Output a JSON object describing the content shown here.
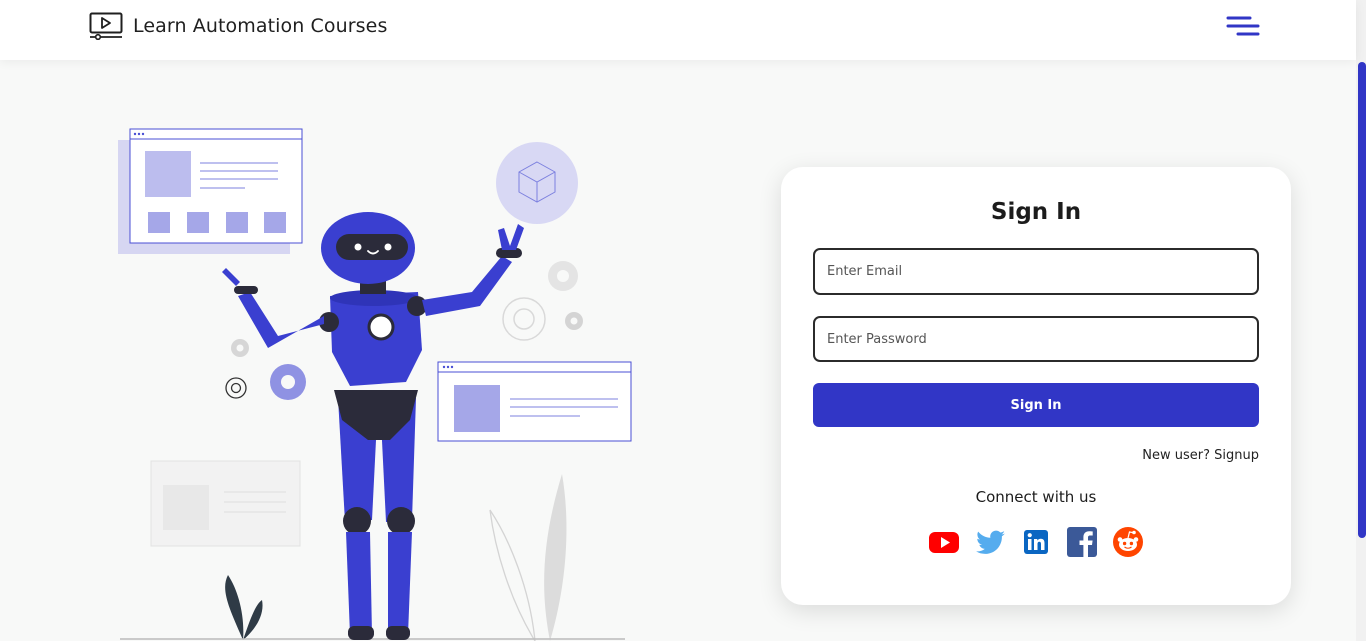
{
  "navbar": {
    "brand_title": "Learn Automation Courses",
    "brand_icon": "video-player-icon",
    "menu_icon": "hamburger-menu-icon"
  },
  "signin": {
    "heading": "Sign In",
    "email_placeholder": "Enter Email",
    "password_placeholder": "Enter Password",
    "button_label": "Sign In",
    "signup_text": "New user? Signup",
    "connect_label": "Connect with us"
  },
  "socials": [
    {
      "name": "youtube-icon",
      "color": "#ff0000"
    },
    {
      "name": "twitter-icon",
      "color": "#55acee"
    },
    {
      "name": "linkedin-icon",
      "color": "#0a66c2"
    },
    {
      "name": "facebook-icon",
      "color": "#3b5998"
    },
    {
      "name": "reddit-icon",
      "color": "#ff4500"
    }
  ],
  "colors": {
    "accent": "#3136c6",
    "robot_body": "#3a3fd0",
    "page_bg": "#f8f9f8"
  }
}
